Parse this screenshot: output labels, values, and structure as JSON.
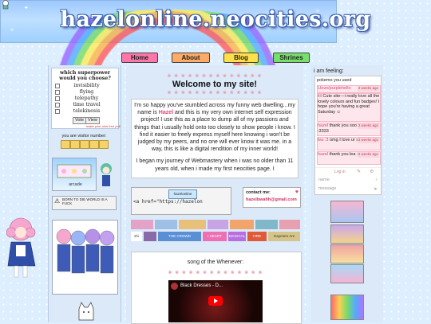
{
  "site": {
    "title": "hazelonline.neocities.org"
  },
  "nav": [
    {
      "label": "Home",
      "color": "#ff77aa"
    },
    {
      "label": "About",
      "color": "#ffaa66"
    },
    {
      "label": "Blog",
      "color": "#ffe04a"
    },
    {
      "label": "Shrines",
      "color": "#77e06a"
    }
  ],
  "poll": {
    "question": "which superpower would you choose?",
    "options": [
      "invisibility",
      "flying",
      "telepathy",
      "time travel",
      "telekinesis"
    ],
    "vote_label": "Vote",
    "view_label": "View",
    "footer": "make your own free poll"
  },
  "counter": {
    "label": "you are visitor number:"
  },
  "arcade": {
    "label": "arcade"
  },
  "warning_badge": {
    "text": "BORN TO DIE WORLD IS A FUCK"
  },
  "welcome": {
    "dots": "❀ ❀ ❀ ❀ ❀ ❀ ❀ ❀ ❀ ❀ ❀ ❀ ❀ ❀",
    "title": "Welcome to my site!",
    "p1_pre": "I'm so happy you've stumbled across my funny web dwelling...my name is ",
    "p1_name": "Hazel",
    "p1_post": " and this is my very own internet self expression project! I use this as a place to dump all of my passions and things that i usually hold onto too closely to show people i know. I find it easier to freely express myself here knowing i won't be judged by my peers, and no one will ever know it was me. in a way, this is like a digital rendition of my inner world!",
    "p2": "I began my journey of Webmastery when i was no older than 11 years old, when i made my first neocities page. I"
  },
  "button_code": {
    "button_text": "hazelonline",
    "code": "<a href=\"https://hazelon"
  },
  "contact": {
    "label": "contact me:",
    "email": "hazelbwahh@gmail.com"
  },
  "stamps": [
    "shi",
    "THE CROWD",
    "I HEART PIXELS",
    "MAGICAL",
    "FIRE",
    "Gaymers Are"
  ],
  "song": {
    "title": "song of the Whenever:",
    "video_title": "Black Dresses - D..."
  },
  "chat": {
    "label": "i am feeling:",
    "messages": [
      {
        "name": "",
        "text": "pokemo you used",
        "date": ""
      },
      {
        "name": "Llove/purplehello",
        "text": "",
        "date": "3 weeks ago"
      },
      {
        "name": "ilil",
        "text": "Cute site---i really love all the lovely colours and fun badges! I hope you're having a great Saturday ☺",
        "date": ""
      },
      {
        "name": "hazel",
        "text": "thank you soo much :3333",
        "date": "3 weeks ago"
      },
      {
        "name": "lea :3",
        "text": "omg I love ur site ☺☺☺",
        "date": "3 weeks ago"
      },
      {
        "name": "hazel",
        "text": "thank you lea :3",
        "date": "3 weeks ago"
      }
    ],
    "login_label": "Log in",
    "name_placeholder": "name",
    "message_placeholder": "message"
  },
  "colors": {
    "accent_pink": "#e0447a",
    "panel_blue": "#dbe9f8"
  }
}
